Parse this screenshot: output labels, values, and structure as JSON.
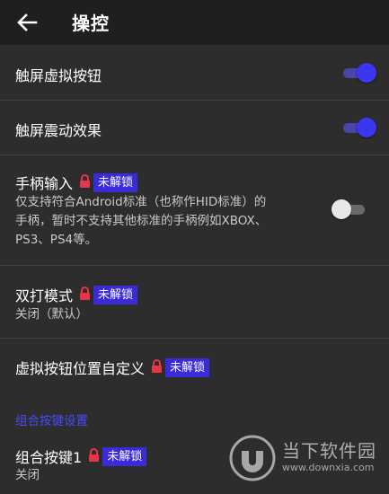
{
  "header": {
    "title": "操控"
  },
  "settings": [
    {
      "title": "触屏虚拟按钮",
      "toggle": "on"
    },
    {
      "title": "触屏震动效果",
      "toggle": "on"
    },
    {
      "title": "手柄输入",
      "badge": "未解锁",
      "desc_lines": [
        "仅支持符合Android标准（也称作HID标准）的",
        "手柄，暂时不支持其他标准的手柄例如XBOX、",
        "PS3、PS4等。"
      ],
      "toggle": "off"
    },
    {
      "title": "双打模式",
      "badge": "未解锁",
      "value": "关闭（默认）"
    },
    {
      "title": "虚拟按钮位置自定义",
      "badge": "未解锁"
    }
  ],
  "combo_section": {
    "header": "组合按键设置",
    "items": [
      {
        "title": "组合按键1",
        "badge": "未解锁",
        "value": "关闭"
      }
    ]
  },
  "watermark": {
    "brand": "当下软件园",
    "url": "www.downxia.com"
  },
  "colors": {
    "background": "#2d2d2d",
    "appbar": "#1f1f1f",
    "accent": "#3b36f0",
    "badge": "#3a2bd9",
    "lock": "#e8354a",
    "section_header": "#4a4aff"
  }
}
